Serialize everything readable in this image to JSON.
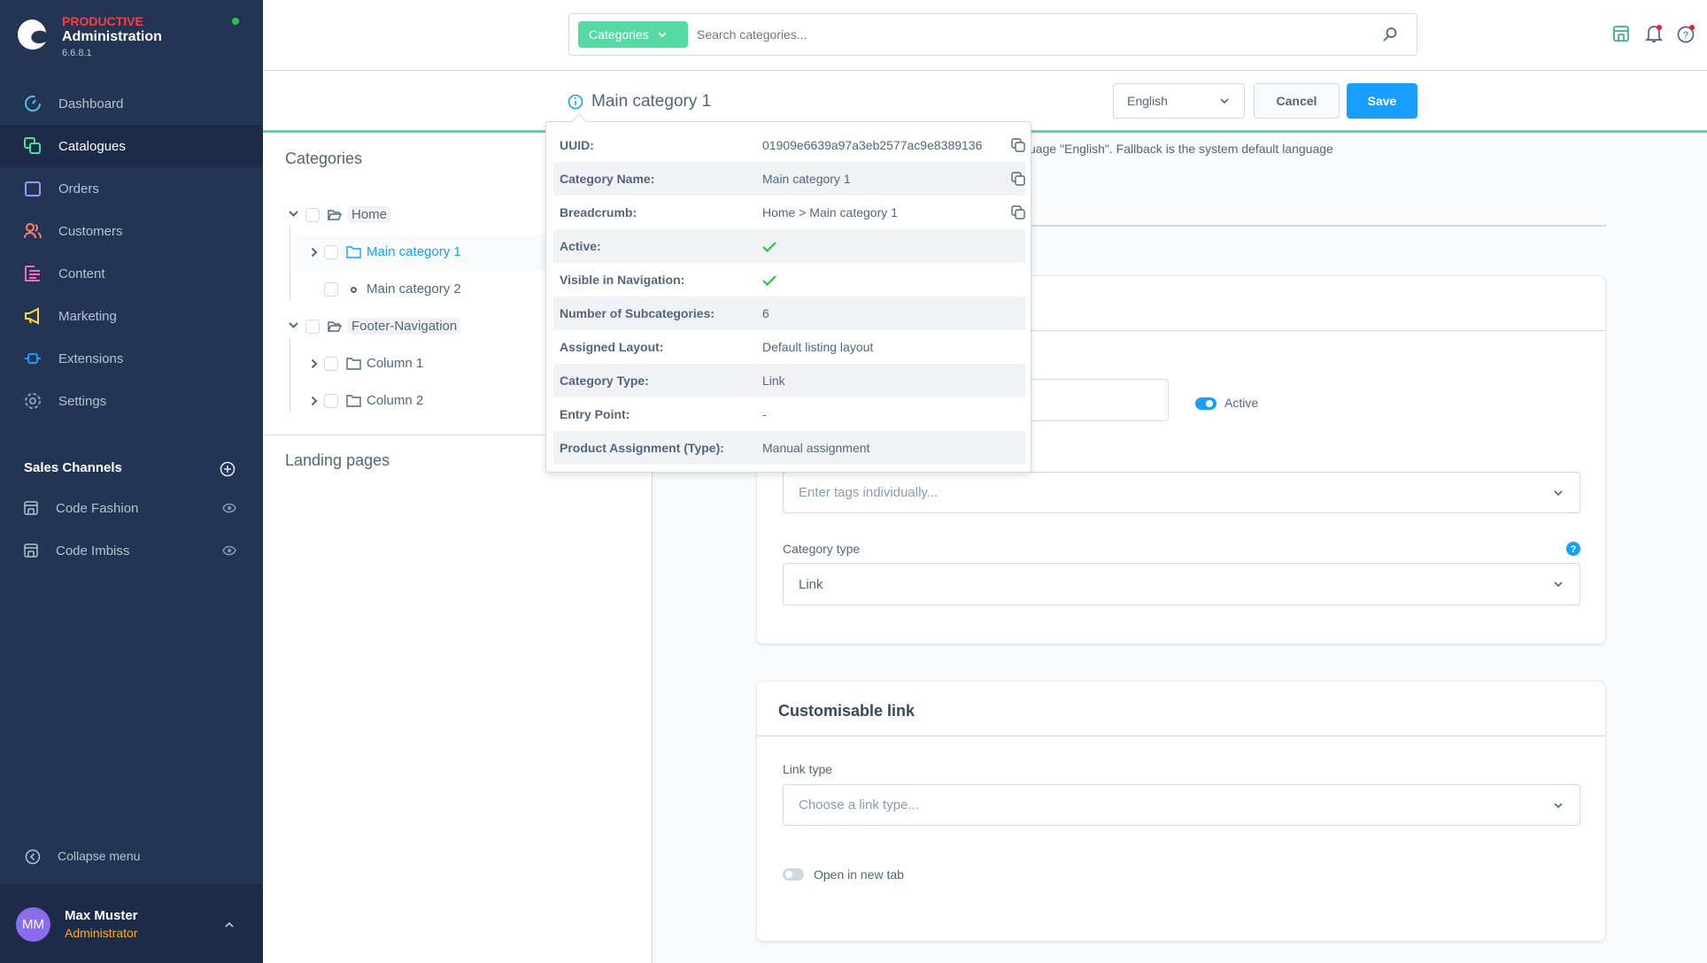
{
  "app": {
    "env": "PRODUCTIVE",
    "title": "Administration",
    "version": "6.6.8.1",
    "status_color": "#2ec24a"
  },
  "sidebar": {
    "items": [
      {
        "label": "Dashboard",
        "icon": "gauge-icon"
      },
      {
        "label": "Catalogues",
        "icon": "catalogue-icon",
        "active": true
      },
      {
        "label": "Orders",
        "icon": "bag-icon"
      },
      {
        "label": "Customers",
        "icon": "users-icon"
      },
      {
        "label": "Content",
        "icon": "content-icon"
      },
      {
        "label": "Marketing",
        "icon": "megaphone-icon"
      },
      {
        "label": "Extensions",
        "icon": "plug-icon"
      },
      {
        "label": "Settings",
        "icon": "gear-icon"
      }
    ],
    "sales_channels_title": "Sales Channels",
    "sales_channels": [
      {
        "label": "Code Fashion"
      },
      {
        "label": "Code Imbiss"
      }
    ],
    "collapse": "Collapse menu",
    "user": {
      "initials": "MM",
      "name": "Max Muster",
      "role": "Administrator"
    }
  },
  "topbar": {
    "search_type": "Categories",
    "search_placeholder": "Search categories..."
  },
  "smartbar": {
    "title": "Main category 1",
    "language": "English",
    "cancel": "Cancel",
    "save": "Save"
  },
  "tree": {
    "title": "Categories",
    "rows": [
      {
        "label": "Home"
      },
      {
        "label": "Main category 1"
      },
      {
        "label": "Main category 2"
      },
      {
        "label": "Footer-Navigation"
      },
      {
        "label": "Column 1"
      },
      {
        "label": "Column 2"
      }
    ],
    "landing": "Landing pages"
  },
  "content": {
    "lang_info": "uage \"English\". Fallback is the system default language",
    "active_label": "Active",
    "active_on": true,
    "tags_placeholder": "Enter tags individually...",
    "category_type_label": "Category type",
    "category_type_value": "Link",
    "link_card_title": "Customisable link",
    "link_type_label": "Link type",
    "link_type_placeholder": "Choose a link type...",
    "new_tab_label": "Open in new tab",
    "new_tab_on": false
  },
  "popover": {
    "rows": [
      {
        "key": "UUID:",
        "value": "01909e6639a97a3eb2577ac9e8389136",
        "copy": true
      },
      {
        "key": "Category Name:",
        "value": "Main category 1",
        "copy": true
      },
      {
        "key": "Breadcrumb:",
        "value": "Home > Main category 1",
        "copy": true
      },
      {
        "key": "Active:",
        "check": true
      },
      {
        "key": "Visible in Navigation:",
        "check": true
      },
      {
        "key": "Number of Subcategories:",
        "value": "6"
      },
      {
        "key": "Assigned Layout:",
        "value": "Default listing layout"
      },
      {
        "key": "Category Type:",
        "value": "Link"
      },
      {
        "key": "Entry Point:",
        "value": "-"
      },
      {
        "key": "Product Assignment (Type):",
        "value": "Manual assignment"
      }
    ]
  },
  "colors": {
    "accent": "#189eff",
    "green": "#57d9a3",
    "sidebar": "#233554",
    "env": "#ff3d3d",
    "role": "#ffab22"
  }
}
